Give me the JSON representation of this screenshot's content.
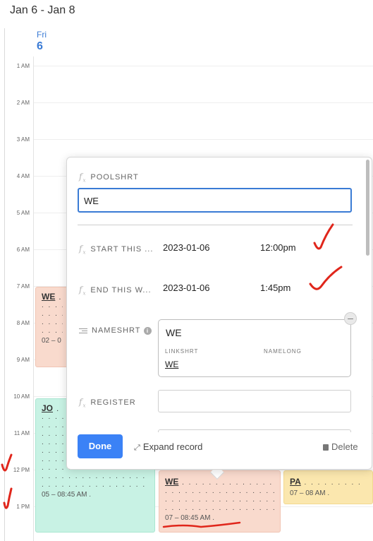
{
  "header": {
    "range": "Jan 6 - Jan 8"
  },
  "day": {
    "name": "Fri",
    "number": "6"
  },
  "hours": [
    "1 AM",
    "2 AM",
    "3 AM",
    "4 AM",
    "5 AM",
    "6 AM",
    "7 AM",
    "8 AM",
    "9 AM",
    "10 AM",
    "11 AM",
    "12 PM",
    "1 PM"
  ],
  "events": {
    "we_left": {
      "title": "WE",
      "dots": ". . . . . . . . . . .",
      "time": "02 – 0"
    },
    "jo": {
      "title": "JO",
      "dots": ". . . . . . . . . . . . . . . . . . . .",
      "time": "05 – 08:45 AM ."
    },
    "we_bottom": {
      "title": "WE",
      "dots": ". . . . . . . . . . . . . . . . . . . . . .",
      "time": "07 – 08:45 AM ."
    },
    "pa": {
      "title": "PA",
      "dots": ". . . . . . . . . . . .",
      "time": "07 – 08 AM ."
    }
  },
  "popup": {
    "poolshrt_label": "POOLSHRT",
    "poolshrt_value": "WE",
    "start_label": "START THIS ...",
    "start_date": "2023-01-06",
    "start_time": "12:00pm",
    "end_label": "END THIS W...",
    "end_date": "2023-01-06",
    "end_time": "1:45pm",
    "nameshrt_label": "NAMESHRT",
    "linked_title": "WE",
    "linked_sub_label_1": "LINKSHRT",
    "linked_sub_label_2": "NAMELONG",
    "linked_link": "WE",
    "register_label": "REGISTER",
    "done_label": "Done",
    "expand_label": "Expand record",
    "delete_label": "Delete"
  },
  "colors": {
    "accent": "#3b82f6",
    "event_salmon": "#f9dacd",
    "event_teal": "#c8f2e4",
    "event_yellow": "#fbe7ae",
    "annotation_red": "#e0261b"
  }
}
